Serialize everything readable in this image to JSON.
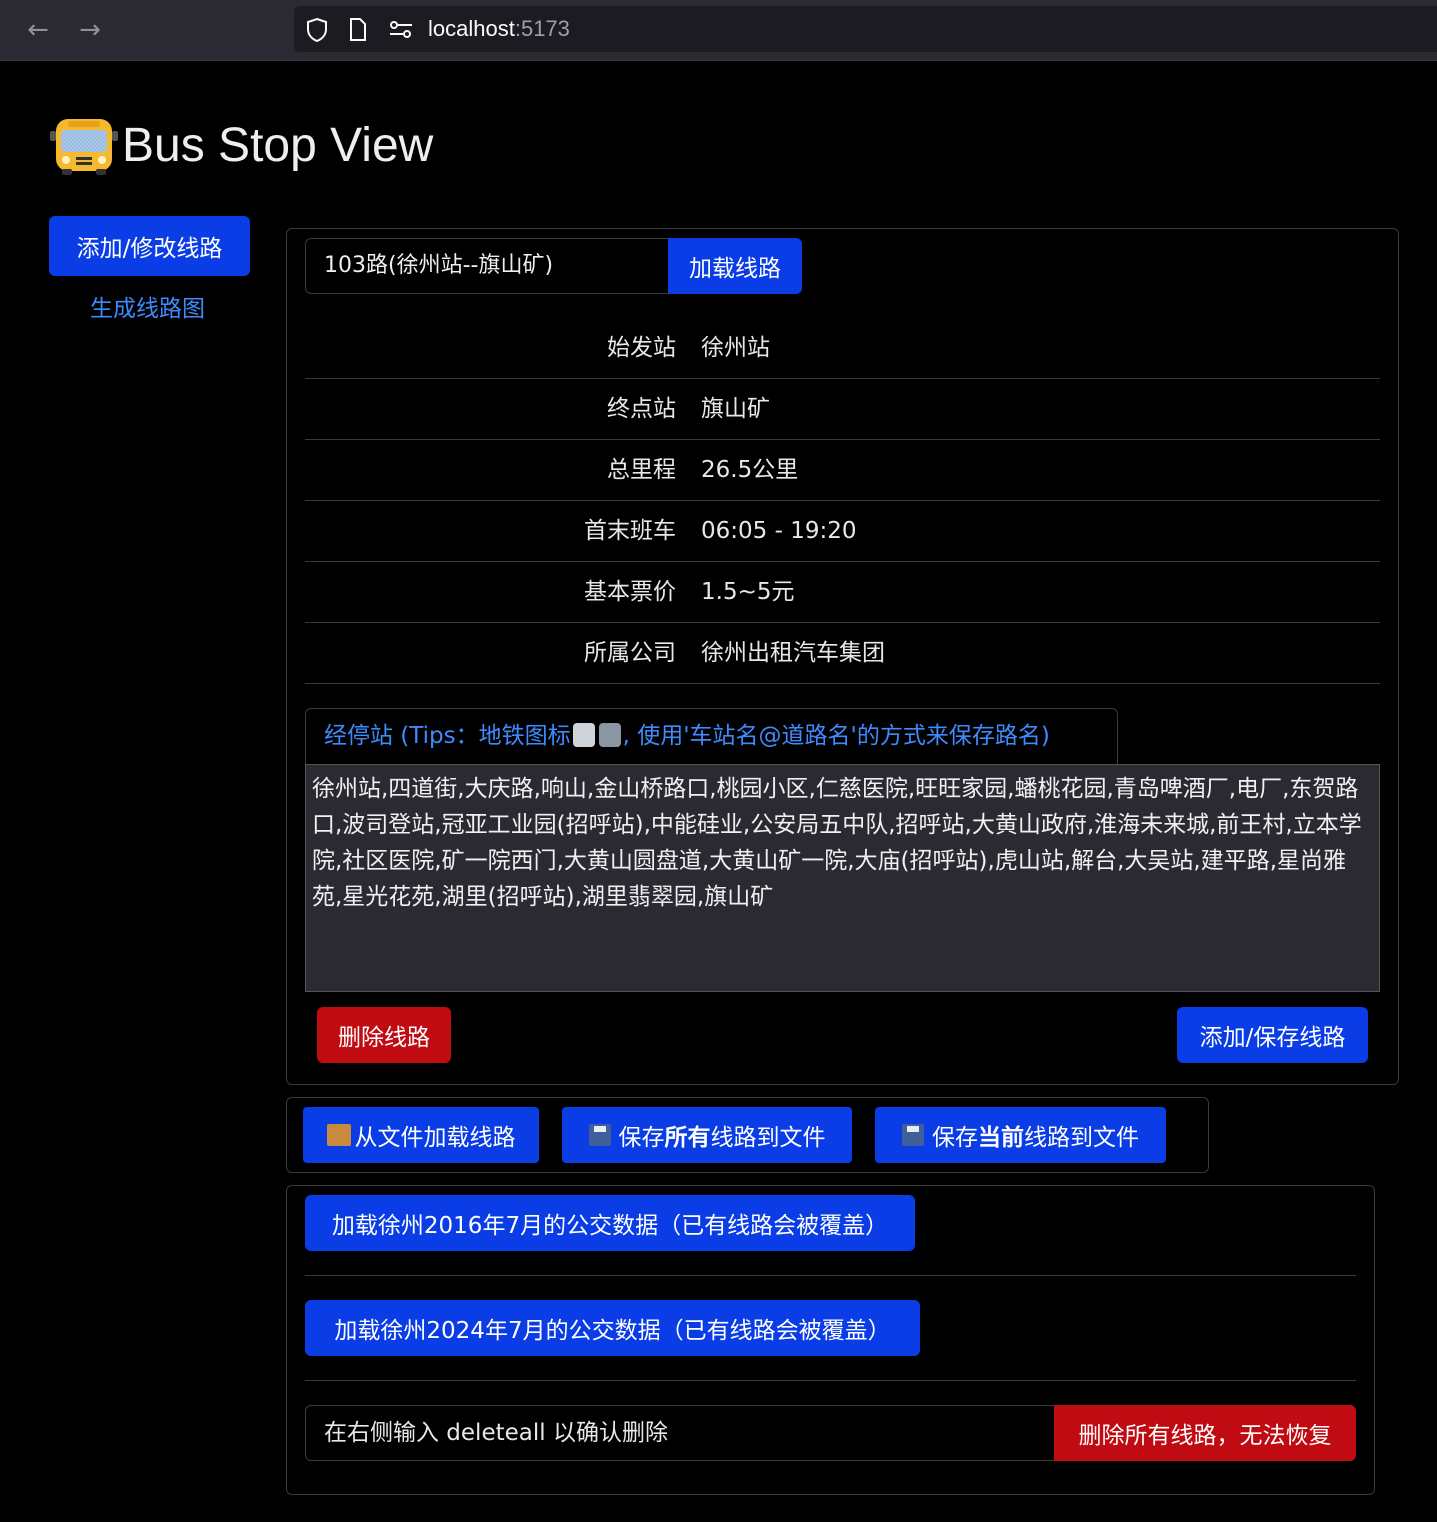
{
  "browser": {
    "url_host": "localhost",
    "url_port": ":5173"
  },
  "app": {
    "title": "Bus Stop View"
  },
  "sidebar": {
    "add_edit_button": "添加/修改线路",
    "generate_map_link": "生成线路图"
  },
  "route": {
    "selected": "103路(徐州站--旗山矿)",
    "load_button": "加载线路",
    "info": [
      {
        "label": "始发站",
        "value": "徐州站"
      },
      {
        "label": "终点站",
        "value": "旗山矿"
      },
      {
        "label": "总里程",
        "value": "26.5公里"
      },
      {
        "label": "首末班车",
        "value": "06:05 - 19:20"
      },
      {
        "label": "基本票价",
        "value": "1.5~5元"
      },
      {
        "label": "所属公司",
        "value": "徐州出租汽车集团"
      }
    ],
    "tips_prefix": "经停站 (Tips：地铁图标",
    "tips_suffix": ", 使用'车站名@道路名'的方式来保存路名)",
    "stations": "徐州站,四道街,大庆路,响山,金山桥路口,桃园小区,仁慈医院,旺旺家园,蟠桃花园,青岛啤酒厂,电厂,东贺路口,波司登站,冠亚工业园(招呼站),中能硅业,公安局五中队,招呼站,大黄山政府,淮海未来城,前王村,立本学院,社区医院,矿一院西门,大黄山圆盘道,大黄山矿一院,大庙(招呼站),虎山站,解台,大吴站,建平路,星尚雅苑,星光花苑,湖里(招呼站),湖里翡翠园,旗山矿",
    "delete_button": "删除线路",
    "save_button": "添加/保存线路"
  },
  "file_actions": {
    "load_from_file": "从文件加载线路",
    "save_all_prefix": "保存",
    "save_all_bold": "所有",
    "save_all_suffix": "线路到文件",
    "save_current_prefix": "保存",
    "save_current_bold": "当前",
    "save_current_suffix": "线路到文件"
  },
  "dataset": {
    "load_2016": "加载徐州2016年7月的公交数据（已有线路会被覆盖）",
    "load_2024": "加载徐州2024年7月的公交数据（已有线路会被覆盖）",
    "confirm_label": "在右侧输入 deleteall 以确认删除",
    "confirm_value": "",
    "delete_all_button": "删除所有线路，无法恢复"
  },
  "colors": {
    "primary": "#0a3de6",
    "danger": "#c00b12",
    "link": "#3d8bfd",
    "background": "#000000"
  }
}
